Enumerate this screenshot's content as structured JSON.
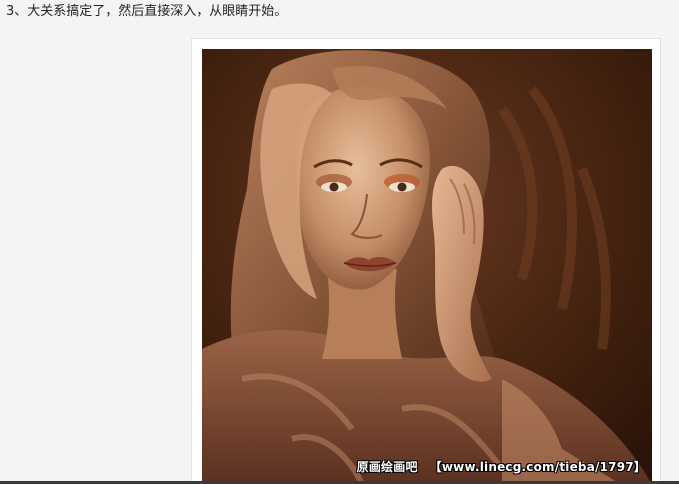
{
  "step": {
    "text": "3、大关系搞定了，然后直接深入，从眼睛开始。"
  },
  "image": {
    "watermark_cn": "原画绘画吧",
    "watermark_url": "【www.linecg.com/tieba/1797】",
    "colors": {
      "background": "#3a1d10",
      "skin": "#d9a882",
      "hair": "#9b6a4a",
      "shadow": "#2a140a"
    }
  }
}
